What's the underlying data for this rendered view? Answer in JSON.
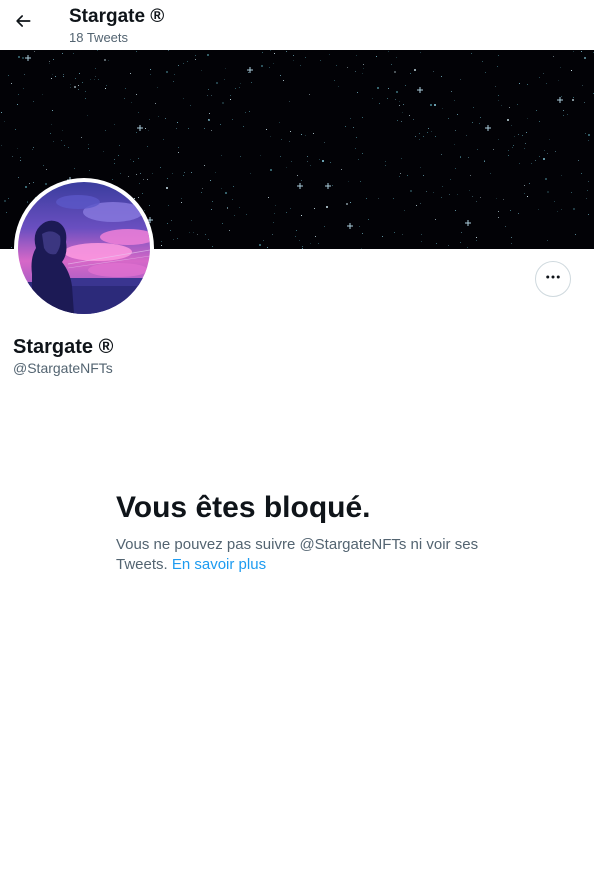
{
  "header": {
    "title": "Stargate ®",
    "tweet_count": "18 Tweets",
    "back_icon": "arrow-left-icon"
  },
  "profile": {
    "display_name": "Stargate ®",
    "handle": "@StargateNFTs",
    "more_icon": "more-horizontal-icon"
  },
  "blocked": {
    "title": "Vous êtes bloqué.",
    "message": "Vous ne pouvez pas suivre @StargateNFTs ni voir ses Tweets.",
    "link_label": "En savoir plus"
  },
  "colors": {
    "accent": "#1d9bf0",
    "text_primary": "#0f1419",
    "text_secondary": "#536471",
    "banner_bg": "#020206"
  }
}
